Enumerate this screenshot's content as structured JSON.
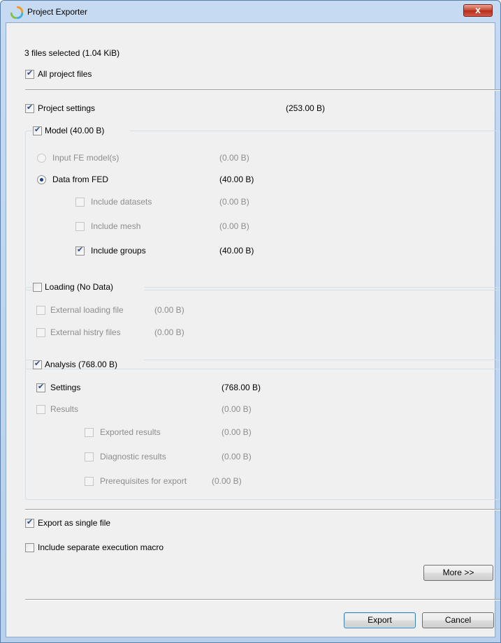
{
  "window": {
    "title": "Project Exporter",
    "close_label": "x"
  },
  "summary": "3 files selected (1.04 KiB)",
  "all_project_files": {
    "label": "All project files",
    "checked": true
  },
  "project_settings": {
    "label": "Project settings",
    "size": "(253.00 B)",
    "checked": true
  },
  "model": {
    "label": "Model (40.00 B)",
    "checked": true,
    "input_fe": {
      "label": "Input FE model(s)",
      "size": "(0.00 B)"
    },
    "data_from_fed": {
      "label": "Data from FED",
      "size": "(40.00 B)"
    },
    "include_datasets": {
      "label": "Include datasets",
      "size": "(0.00 B)"
    },
    "include_mesh": {
      "label": "Include mesh",
      "size": "(0.00 B)"
    },
    "include_groups": {
      "label": "Include groups",
      "size": "(40.00 B)"
    }
  },
  "loading": {
    "label": "Loading (No Data)",
    "external_loading": {
      "label": "External loading file",
      "size": "(0.00 B)"
    },
    "external_history": {
      "label": "External histry files",
      "size": "(0.00 B)"
    }
  },
  "analysis": {
    "label": "Analysis (768.00 B)",
    "settings": {
      "label": "Settings",
      "size": "(768.00 B)"
    },
    "results": {
      "label": "Results",
      "size": "(0.00 B)"
    },
    "exported_results": {
      "label": "Exported results",
      "size": "(0.00 B)"
    },
    "diagnostic_results": {
      "label": "Diagnostic results",
      "size": "(0.00 B)"
    },
    "prerequisites": {
      "label": "Prerequisites for export",
      "size": "(0.00 B)"
    }
  },
  "export_single": {
    "label": "Export as single file",
    "checked": true
  },
  "include_macro": {
    "label": "Include separate execution macro",
    "checked": false
  },
  "buttons": {
    "more": "More >>",
    "export": "Export",
    "cancel": "Cancel"
  }
}
